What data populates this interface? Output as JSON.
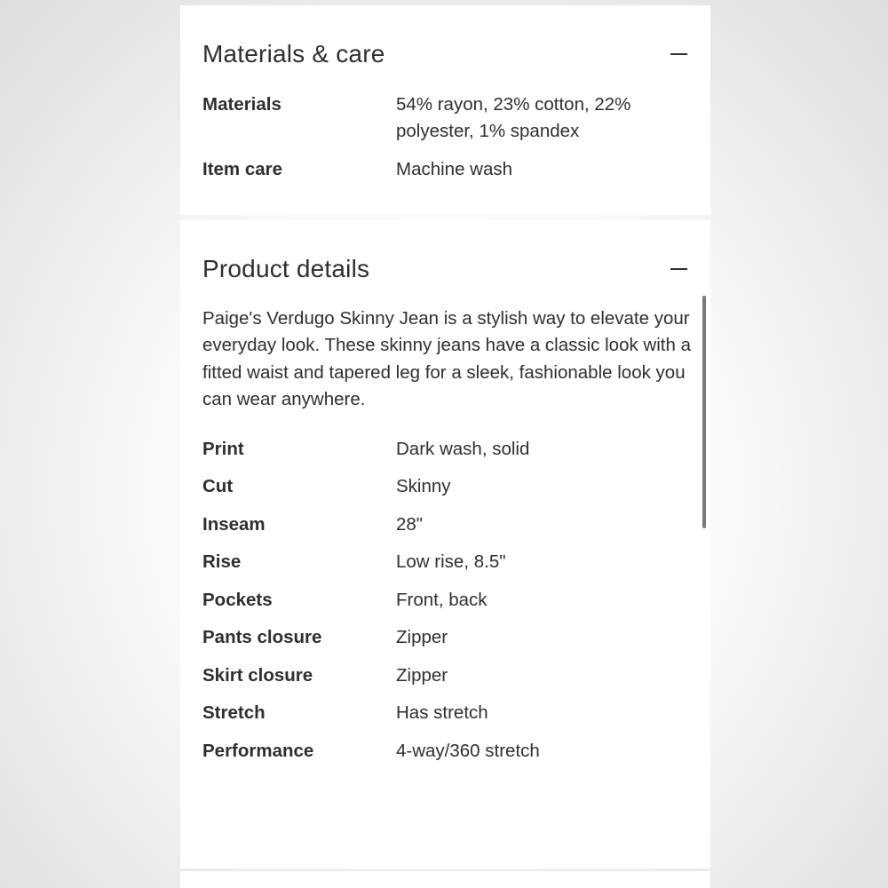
{
  "materials_care": {
    "title": "Materials & care",
    "rows": [
      {
        "label": "Materials",
        "value": "54% rayon, 23% cotton, 22% polyester, 1% spandex"
      },
      {
        "label": "Item care",
        "value": "Machine wash"
      }
    ]
  },
  "product_details": {
    "title": "Product details",
    "description": "Paige's Verdugo Skinny Jean is a stylish way to elevate your everyday look. These skinny jeans have a classic look with a fitted waist and tapered leg for a sleek, fashionable look you can wear anywhere.",
    "rows": [
      {
        "label": "Print",
        "value": "Dark wash, solid"
      },
      {
        "label": "Cut",
        "value": "Skinny"
      },
      {
        "label": "Inseam",
        "value": "28\""
      },
      {
        "label": "Rise",
        "value": "Low rise, 8.5\""
      },
      {
        "label": "Pockets",
        "value": "Front, back"
      },
      {
        "label": "Pants closure",
        "value": "Zipper"
      },
      {
        "label": "Skirt closure",
        "value": "Zipper"
      },
      {
        "label": "Stretch",
        "value": "Has stretch"
      },
      {
        "label": "Performance",
        "value": "4-way/360 stretch"
      }
    ]
  },
  "icons": {
    "collapse": "minus-icon"
  },
  "colors": {
    "text": "#2e2f32",
    "panel": "#ffffff",
    "scrollbar": "#7a7a7a"
  }
}
